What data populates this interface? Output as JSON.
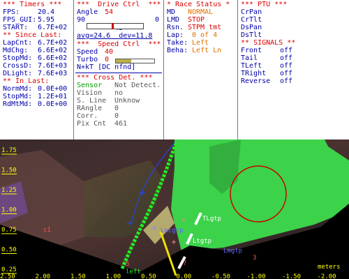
{
  "timers": {
    "header": "*** Timers ***",
    "fps": {
      "label": "FPS:",
      "value": "20.4"
    },
    "fps_gui": {
      "label": "FPS_GUI:",
      "value": "5.95"
    },
    "start": {
      "label": "START:",
      "value": "6.7E+02"
    },
    "since_header": "** Since Last:",
    "lapcnt": {
      "label": "LapCnt:",
      "value": "6.7E+02"
    },
    "mdchg": {
      "label": "MdChg:",
      "value": "6.6E+02"
    },
    "stopmd": {
      "label": "StopMd:",
      "value": "6.6E+02"
    },
    "crossd": {
      "label": "CrossD:",
      "value": "7.6E+03"
    },
    "dlight": {
      "label": "DLight:",
      "value": "7.6E+03"
    },
    "inlast_header": "** In Last:",
    "normmd": {
      "label": "NormMd:",
      "value": "0.0E+00"
    },
    "stopmd2": {
      "label": "StopMd:",
      "value": "1.2E+01"
    },
    "rdmtmd": {
      "label": "RdMtMd:",
      "value": "0.0E+00"
    }
  },
  "drive": {
    "header": "***  Drive Ctrl  ***",
    "angle_label": "Angle",
    "angle_value": "54",
    "slider_min": "90",
    "slider_max": "0",
    "slider_level": 0.45,
    "slider_readout": "45",
    "avg_line": "avg=24.6  dev=11.8",
    "speed_header": "***  Speed Ctrl  ***",
    "speed_label": "Speed",
    "speed_value": "40",
    "speed_level": 0.4,
    "turbo_label": "Turbo",
    "turbo_value": "0",
    "nkt_line": "N+kT [DC nfnd]"
  },
  "crossdet": {
    "header": "*** Cross Det. ***",
    "sensor": {
      "label": "Sensor",
      "value": "Not Detect."
    },
    "vision": {
      "label": "Vision",
      "value": "no"
    },
    "sline": {
      "label": "S. Line",
      "value": "Unknow"
    },
    "rangle": {
      "label": "RAngle",
      "value": "0"
    },
    "corr": {
      "label": "Corr.",
      "value": "0"
    },
    "pixcnt": {
      "label": "Pix Cnt",
      "value": "461"
    }
  },
  "race": {
    "header": "* Race Status *",
    "md": {
      "label": "MD",
      "value": "NORMAL"
    },
    "lmd": {
      "label": "LMD",
      "value": "STOP"
    },
    "rsn": {
      "label": "Rsn.",
      "value": "STPM tmt"
    },
    "lap": {
      "label": "Lap:",
      "value": "0 of 4"
    },
    "take": {
      "label": "Take:",
      "value": "Left"
    },
    "beha": {
      "label": "Beha:",
      "value": "Left Ln"
    }
  },
  "ptu": {
    "header": "*** PTU ***",
    "items": [
      "CrPan",
      "CrTlt",
      "DsPan",
      "DsTlt"
    ]
  },
  "signals": {
    "header": "** SIGNALS **",
    "items": [
      {
        "label": "Front",
        "value": "off"
      },
      {
        "label": "Tail",
        "value": "off"
      },
      {
        "label": "TLeft",
        "value": "off"
      },
      {
        "label": "TRight",
        "value": "off"
      },
      {
        "label": "Reverse",
        "value": "off"
      }
    ]
  },
  "camera": {
    "left_ticks": [
      "1.75",
      "1.50",
      "1.25",
      "1.00",
      "0.75",
      "0.50",
      "0.25"
    ],
    "bottom_ticks": [
      "2.50",
      "2.00",
      "1.50",
      "1.00",
      "0.50",
      "0.00",
      "-0.50",
      "-1.00",
      "-1.50",
      "-2.00"
    ],
    "units": "meters",
    "labels": {
      "ltgtp_upper": "TLgtp",
      "lmcgtp": "Lmcgtp",
      "ltgtp": "Ltgtp",
      "lmgtp": "Lmgtp",
      "left": "left",
      "c1": "c1",
      "m5": "5",
      "m7": "7",
      "m3": "3"
    },
    "colors": {
      "green_lane": "#3cd24a",
      "lane_marker": "#22ee22",
      "circle": "#cc0000",
      "ticks": "#ffff00"
    }
  }
}
